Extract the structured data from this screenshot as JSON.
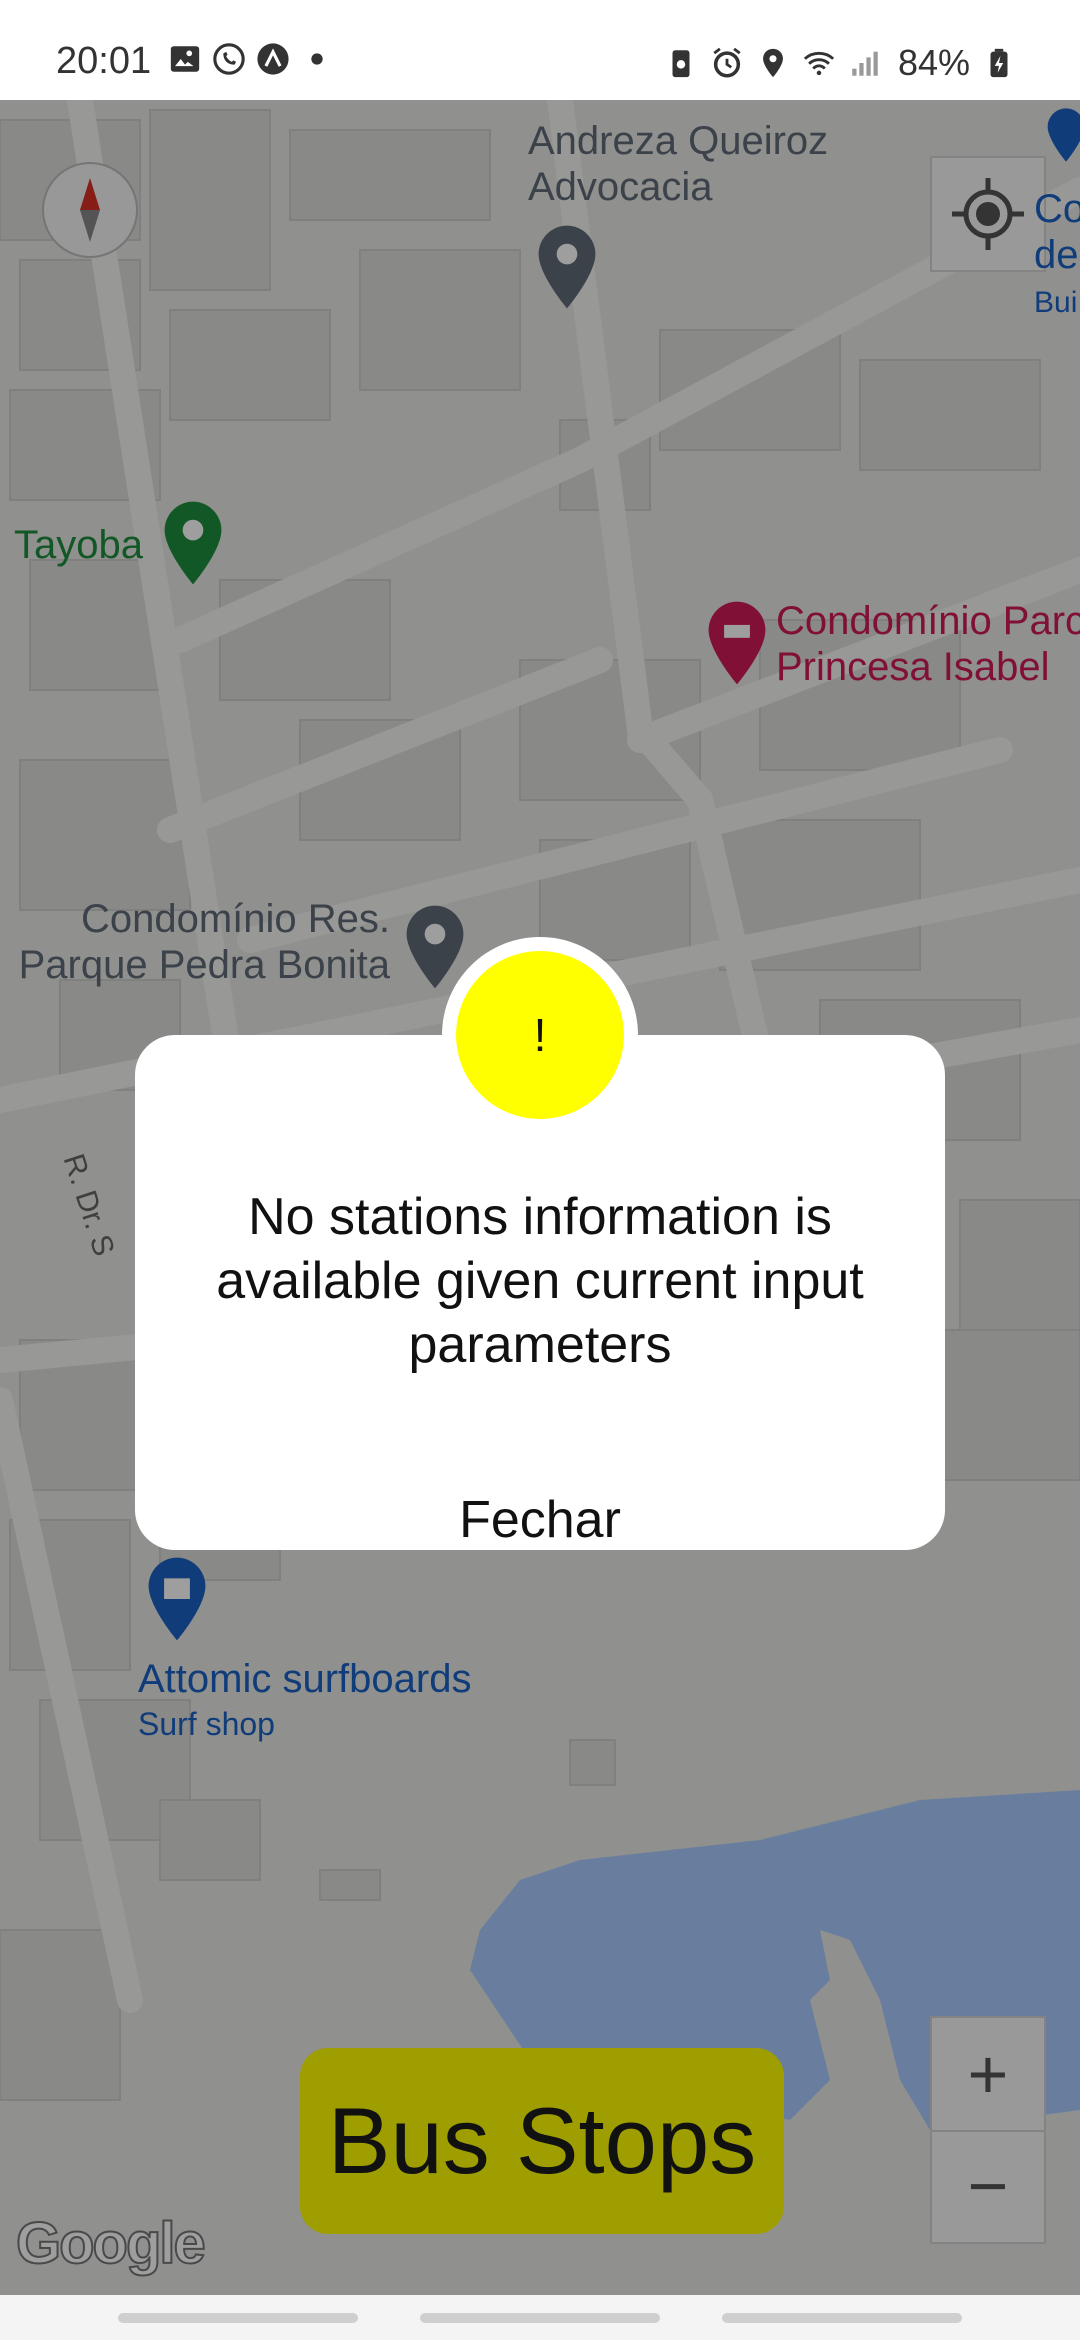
{
  "status_bar": {
    "time": "20:01",
    "battery_percent": "84%",
    "left_icons": [
      "gallery-icon",
      "whatsapp-icon",
      "app-icon",
      "dot-icon"
    ],
    "right_icons": [
      "battery-saver-icon",
      "alarm-icon",
      "location-icon",
      "wifi-icon",
      "signal-icon",
      "battery-icon"
    ]
  },
  "map": {
    "labels": {
      "andreza": "Andreza Queiroz\nAdvocacia",
      "tayoba": "Tayoba",
      "condominio_parque": "Condomínio Parc\nPrincesa Isabel",
      "condominio_res": "Condomínio Res.\nParque Pedra Bonita",
      "street": "R. Dr. S",
      "attomic": "Attomic surfboards",
      "attomic_sub": "Surf shop",
      "top_right": "Co\nde",
      "top_right_sub": "Bui"
    },
    "google_logo": "Google",
    "zoom_in": "+",
    "zoom_out": "−",
    "colors": {
      "water": "#aaccff",
      "poi_green": "#1e8e3e",
      "poi_pink": "#d01a5a",
      "poi_blue": "#1a62c6",
      "poi_gray": "#5f6b78"
    }
  },
  "bus_stops_button": "Bus Stops",
  "dialog": {
    "icon_symbol": "!",
    "message": "No stations information is available given current input parameters",
    "close_label": "Fechar"
  }
}
